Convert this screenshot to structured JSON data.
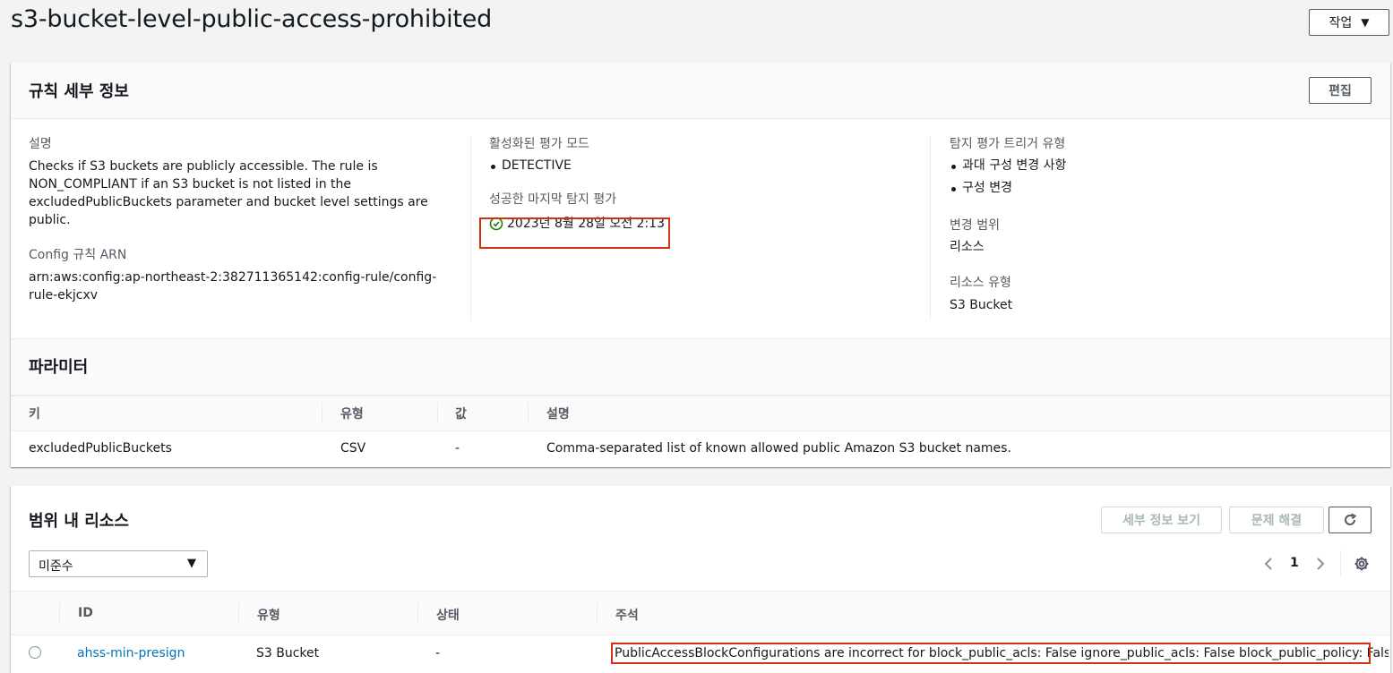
{
  "page": {
    "title": "s3-bucket-level-public-access-prohibited",
    "actions_label": "작업"
  },
  "rule_details": {
    "heading": "규칙 세부 정보",
    "edit_label": "편집",
    "description_label": "설명",
    "description_value": "Checks if S3 buckets are publicly accessible. The rule is NON_COMPLIANT if an S3 bucket is not listed in the excludedPublicBuckets parameter and bucket level settings are public.",
    "arn_label": "Config 규칙 ARN",
    "arn_value": "arn:aws:config:ap-northeast-2:382711365142:config-rule/config-rule-ekjcxv",
    "eval_mode_label": "활성화된 평가 모드",
    "eval_modes": [
      "DETECTIVE"
    ],
    "last_eval_label": "성공한 마지막 탐지 평가",
    "last_eval_value": "2023년 8월 28일 오전 2:13",
    "trigger_label": "탐지 평가 트리거 유형",
    "triggers": [
      "과대 구성 변경 사항",
      "구성 변경"
    ],
    "scope_label": "변경 범위",
    "scope_value": "리소스",
    "resource_type_label": "리소스 유형",
    "resource_type_value": "S3 Bucket"
  },
  "parameters": {
    "heading": "파라미터",
    "columns": [
      "키",
      "유형",
      "값",
      "설명"
    ],
    "rows": [
      {
        "key": "excludedPublicBuckets",
        "type": "CSV",
        "value": "-",
        "description": "Comma-separated list of known allowed public Amazon S3 bucket names."
      }
    ]
  },
  "resources": {
    "heading": "범위 내 리소스",
    "details_label": "세부 정보 보기",
    "remediate_label": "문제 해결",
    "filter_value": "미준수",
    "page_number": "1",
    "columns": [
      "ID",
      "유형",
      "상태",
      "주석"
    ],
    "rows": [
      {
        "id": "ahss-min-presign",
        "type": "S3 Bucket",
        "status": "-",
        "annotation": "PublicAccessBlockConfigurations are incorrect for block_public_acls: False ignore_public_acls: False block_public_policy: False restrict_public_buckets: False"
      }
    ]
  },
  "colors": {
    "link": "#0073bb",
    "highlight": "#d13212",
    "success": "#1d8102"
  }
}
